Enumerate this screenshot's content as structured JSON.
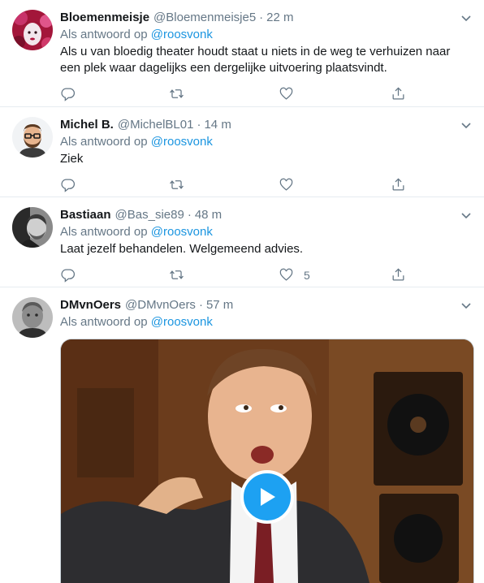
{
  "tweets": [
    {
      "name": "Bloemenmeisje",
      "handle": "@Bloemenmeisje5",
      "dot": "·",
      "time": "22 m",
      "reply_prefix": "Als antwoord op",
      "reply_mention": "@roosvonk",
      "text": "Als u van bloedig theater houdt staat u niets in de weg te verhuizen naar een plek waar dagelijks een dergelijke uitvoering plaatsvindt.",
      "like_count": "",
      "avatar_icon": "avatar-bloemenmeisje-icon"
    },
    {
      "name": "Michel B.",
      "handle": "@MichelBL01",
      "dot": "·",
      "time": "14 m",
      "reply_prefix": "Als antwoord op",
      "reply_mention": "@roosvonk",
      "text": "Ziek",
      "like_count": "",
      "avatar_icon": "avatar-michel-icon"
    },
    {
      "name": "Bastiaan",
      "handle": "@Bas_sie89",
      "dot": "·",
      "time": "48 m",
      "reply_prefix": "Als antwoord op",
      "reply_mention": "@roosvonk",
      "text": "Laat jezelf behandelen. Welgemeend advies.",
      "like_count": "5",
      "avatar_icon": "avatar-bastiaan-icon"
    },
    {
      "name": "DMvnOers",
      "handle": "@DMvnOers",
      "dot": "·",
      "time": "57 m",
      "reply_prefix": "Als antwoord op",
      "reply_mention": "@roosvonk",
      "text": "",
      "media": "gif-video",
      "avatar_icon": "avatar-dmvnoers-icon"
    }
  ],
  "icons": {
    "reply": "reply-icon",
    "retweet": "retweet-icon",
    "like": "heart-icon",
    "share": "share-icon",
    "caret": "chevron-down-icon",
    "play": "play-icon"
  },
  "colors": {
    "link": "#1b95e0",
    "muted": "#657786",
    "divider": "#e6ecf0",
    "play": "#1da1f2"
  }
}
